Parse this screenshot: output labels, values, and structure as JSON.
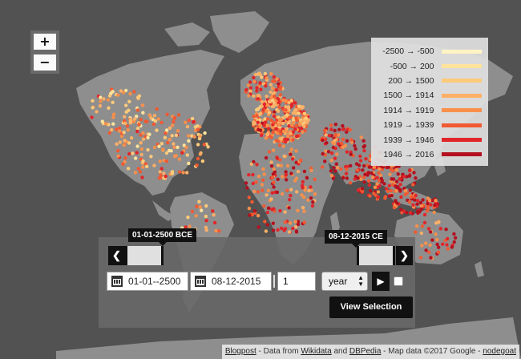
{
  "zoom": {
    "in_label": "+",
    "out_label": "−"
  },
  "legend": {
    "items": [
      {
        "label": "-2500 → -500",
        "color": "#fff4c2"
      },
      {
        "label": "-500 → 200",
        "color": "#fee39c"
      },
      {
        "label": "200 → 1500",
        "color": "#fdca7a"
      },
      {
        "label": "1500 → 1914",
        "color": "#fbb068"
      },
      {
        "label": "1914 → 1919",
        "color": "#f8904c"
      },
      {
        "label": "1919 → 1939",
        "color": "#f05a33"
      },
      {
        "label": "1939 → 1946",
        "color": "#e0262a"
      },
      {
        "label": "1946 → 2016",
        "color": "#b4101f"
      }
    ]
  },
  "timeline": {
    "start_tip": "01-01-2500 BCE",
    "end_tip": "08-12-2015 CE",
    "prev_icon": "chevron-left-icon",
    "next_icon": "chevron-right-icon",
    "prev_label": "❮",
    "next_label": "❯",
    "start_date": "01-01--2500",
    "end_date": "08-12-2015",
    "step_value": "1",
    "step_unit": "year",
    "play_label": "▶",
    "view_button": "View Selection"
  },
  "attribution": {
    "blogpost": "Blogpost",
    "data_from": " - Data from ",
    "wikidata": "Wikidata",
    "and": " and ",
    "dbpedia": "DBPedia",
    "map_data": " - Map data ©2017 Google - ",
    "nodegoat": "nodegoat"
  },
  "colors": {
    "background": "#525252",
    "land": "#8e8e8e",
    "panel": "#686868"
  }
}
